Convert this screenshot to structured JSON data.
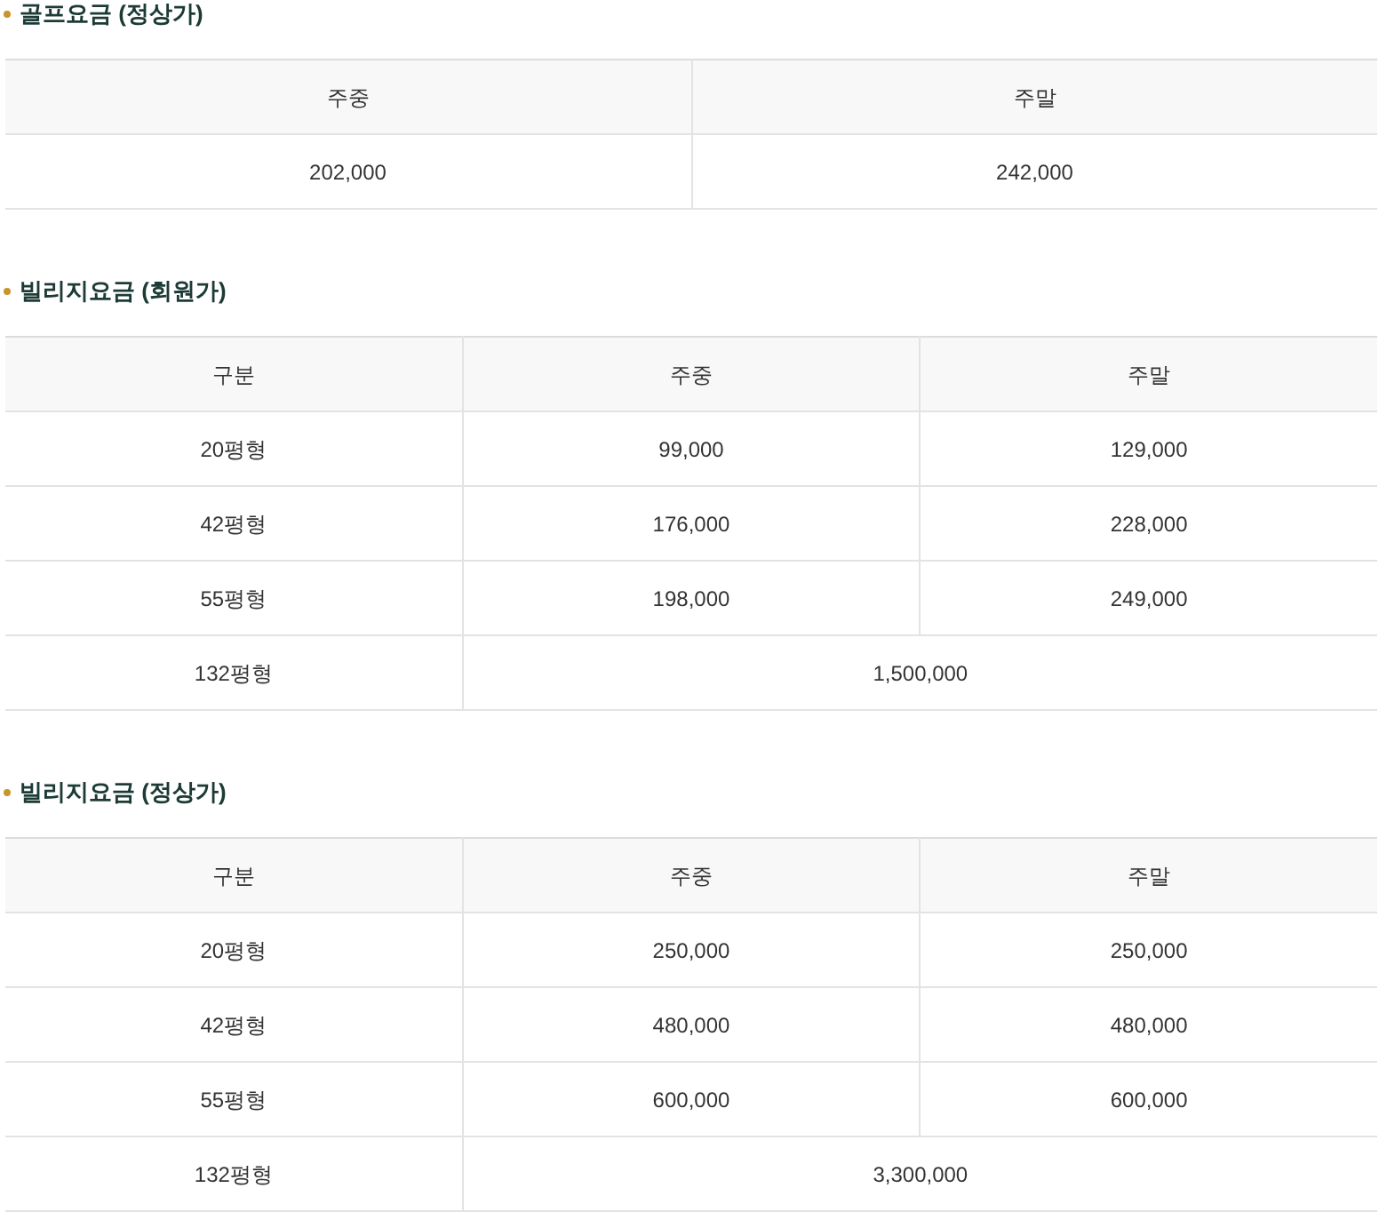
{
  "sections": [
    {
      "title": "골프요금 (정상가)",
      "columns": [
        "주중",
        "주말"
      ],
      "rows": [
        {
          "cells": [
            "202,000",
            "242,000"
          ]
        }
      ]
    },
    {
      "title": "빌리지요금 (회원가)",
      "columns": [
        "구분",
        "주중",
        "주말"
      ],
      "rows": [
        {
          "cells": [
            "20평형",
            "99,000",
            "129,000"
          ]
        },
        {
          "cells": [
            "42평형",
            "176,000",
            "228,000"
          ]
        },
        {
          "cells": [
            "55평형",
            "198,000",
            "249,000"
          ]
        },
        {
          "cells": [
            "132평형",
            {
              "text": "1,500,000",
              "colspan": 2
            }
          ]
        }
      ]
    },
    {
      "title": "빌리지요금 (정상가)",
      "columns": [
        "구분",
        "주중",
        "주말"
      ],
      "rows": [
        {
          "cells": [
            "20평형",
            "250,000",
            "250,000"
          ]
        },
        {
          "cells": [
            "42평형",
            "480,000",
            "480,000"
          ]
        },
        {
          "cells": [
            "55평형",
            "600,000",
            "600,000"
          ]
        },
        {
          "cells": [
            "132평형",
            {
              "text": "3,300,000",
              "colspan": 2
            }
          ]
        }
      ]
    }
  ]
}
